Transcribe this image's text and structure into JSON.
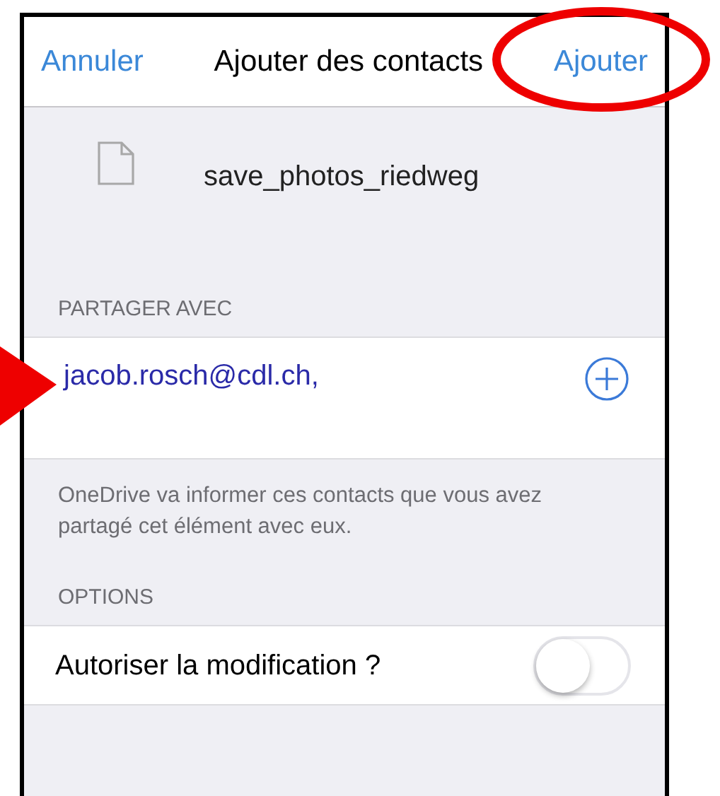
{
  "nav_bar": {
    "cancel": "Annuler",
    "title": "Ajouter des contacts",
    "confirm": "Ajouter"
  },
  "file": {
    "name": "save_photos_riedweg"
  },
  "share_section": {
    "header": "PARTAGER AVEC",
    "recipients": "jacob.rosch@cdl.ch,",
    "footer": "OneDrive va informer ces contacts que vous avez partagé cet élément avec eux."
  },
  "options_section": {
    "header": "OPTIONS",
    "rows": [
      {
        "kind": "toggle",
        "label": "Autoriser la modification ?",
        "on": false
      }
    ]
  }
}
